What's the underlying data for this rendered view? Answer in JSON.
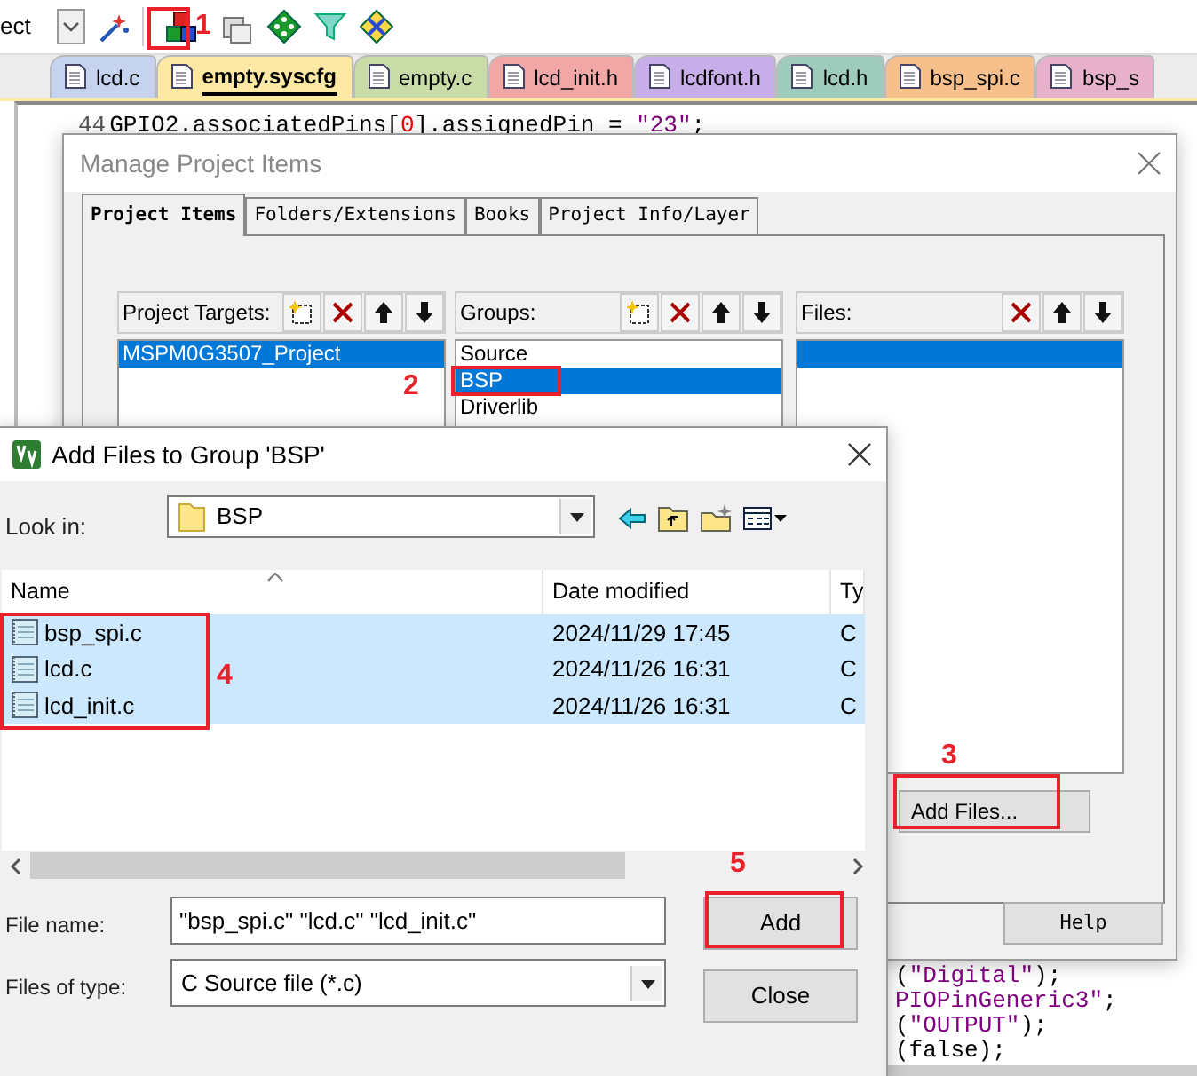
{
  "toolbar": {
    "combo_text": "ect"
  },
  "editor_tabs": [
    {
      "label": "lcd.c",
      "color": "#c5d3ef",
      "selected": false
    },
    {
      "label": "empty.syscfg",
      "color": "#fde9a4",
      "selected": true
    },
    {
      "label": "empty.c",
      "color": "#c9dca8",
      "selected": false
    },
    {
      "label": "lcd_init.h",
      "color": "#f2a7a7",
      "selected": false
    },
    {
      "label": "lcdfont.h",
      "color": "#c8aee8",
      "selected": false
    },
    {
      "label": "lcd.h",
      "color": "#9fcbbd",
      "selected": false
    },
    {
      "label": "bsp_spi.c",
      "color": "#f7bf8c",
      "selected": false
    },
    {
      "label": "bsp_s",
      "color": "#e7b1cc",
      "selected": false
    }
  ],
  "code_top": {
    "line_number": "44",
    "segments": [
      {
        "kind": "plain",
        "text": "GPIO2.associatedPins["
      },
      {
        "kind": "number",
        "text": "0"
      },
      {
        "kind": "plain",
        "text": "].assignedPin = "
      },
      {
        "kind": "string",
        "text": "\"23\""
      },
      {
        "kind": "plain",
        "text": ";"
      }
    ]
  },
  "code_fragments": [
    [
      {
        "kind": "plain",
        "text": "("
      },
      {
        "kind": "string",
        "text": "\"Digital\""
      },
      {
        "kind": "plain",
        "text": ");"
      }
    ],
    [
      {
        "kind": "string",
        "text": "PIOPinGeneric3\""
      },
      {
        "kind": "plain",
        "text": ";"
      }
    ],
    [
      {
        "kind": "plain",
        "text": "("
      },
      {
        "kind": "string",
        "text": "\"OUTPUT\""
      },
      {
        "kind": "plain",
        "text": ");"
      }
    ],
    [
      {
        "kind": "plain",
        "text": "(false);"
      }
    ]
  ],
  "manage_dialog": {
    "title": "Manage Project Items",
    "tabs": [
      {
        "label": "Project Items",
        "selected": true
      },
      {
        "label": "Folders/Extensions",
        "selected": false
      },
      {
        "label": "Books",
        "selected": false
      },
      {
        "label": "Project Info/Layer",
        "selected": false
      }
    ],
    "targets": {
      "label": "Project Targets:",
      "items": [
        {
          "text": "MSPM0G3507_Project",
          "selected": true
        }
      ]
    },
    "groups": {
      "label": "Groups:",
      "items": [
        {
          "text": "Source",
          "selected": false
        },
        {
          "text": "BSP",
          "selected": true
        },
        {
          "text": "Driverlib",
          "selected": false
        }
      ]
    },
    "files": {
      "label": "Files:",
      "empty_row_selected": true
    },
    "add_files_button": "Add Files...",
    "help_button": "Help"
  },
  "add_dialog": {
    "title": "Add Files to Group 'BSP'",
    "look_in_label": "Look in:",
    "look_in_value": "BSP",
    "columns": [
      "Name",
      "Date modified",
      "Ty"
    ],
    "rows": [
      {
        "name": "bsp_spi.c",
        "date": "2024/11/29 17:45",
        "type": "C",
        "selected": true
      },
      {
        "name": "lcd.c",
        "date": "2024/11/26 16:31",
        "type": "C",
        "selected": true
      },
      {
        "name": "lcd_init.c",
        "date": "2024/11/26 16:31",
        "type": "C",
        "selected": true
      }
    ],
    "file_name_label": "File name:",
    "file_name_value": "\"bsp_spi.c\" \"lcd.c\" \"lcd_init.c\"",
    "file_type_label": "Files of type:",
    "file_type_value": "C Source file (*.c)",
    "add_button": "Add",
    "close_button": "Close"
  },
  "annotations": [
    {
      "number": "1"
    },
    {
      "number": "2"
    },
    {
      "number": "3"
    },
    {
      "number": "4"
    },
    {
      "number": "5"
    }
  ]
}
